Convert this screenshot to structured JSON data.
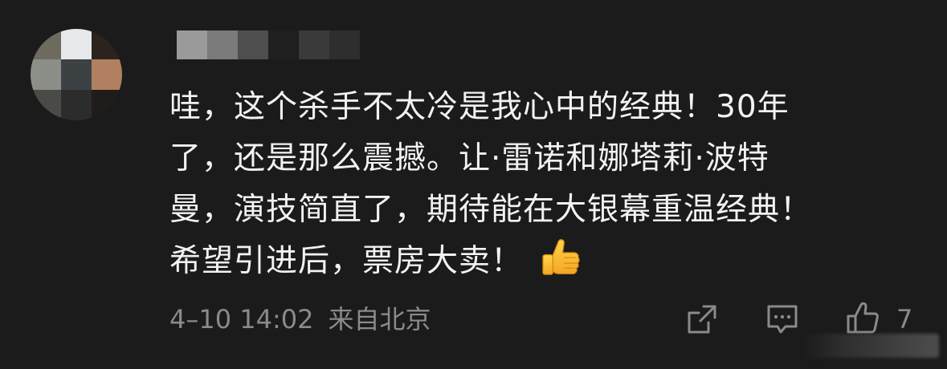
{
  "avatar": {
    "cells": [
      "#6f6a60",
      "#e6e8ea",
      "#2b241e",
      "#8c8e88",
      "#3c4244",
      "#b08060",
      "#4a4a46",
      "#2c2c2c",
      "#1f1c1a"
    ]
  },
  "username": {
    "blocks": [
      "#9a9a9a",
      "#7a7a7a",
      "#4e4e4e",
      "#1f1f1f",
      "#3a3a3a",
      "#2e2e2e"
    ]
  },
  "comment": {
    "line1": "哇，这个杀手不太冷是我心中的经典！30年",
    "line2": "了，还是那么震撼。让·雷诺和娜塔莉·波特",
    "line3": "曼，演技简直了，期待能在大银幕重温经典！",
    "line4": "希望引进后，票房大卖！",
    "emoji": "thumbs-up"
  },
  "meta": {
    "timestamp": "4–10 14:02",
    "location": "来自北京"
  },
  "actions": {
    "like_count": "7"
  },
  "colors": {
    "background": "#1b1b1b",
    "text": "#f2f2f2",
    "muted": "#8a8a8a"
  }
}
